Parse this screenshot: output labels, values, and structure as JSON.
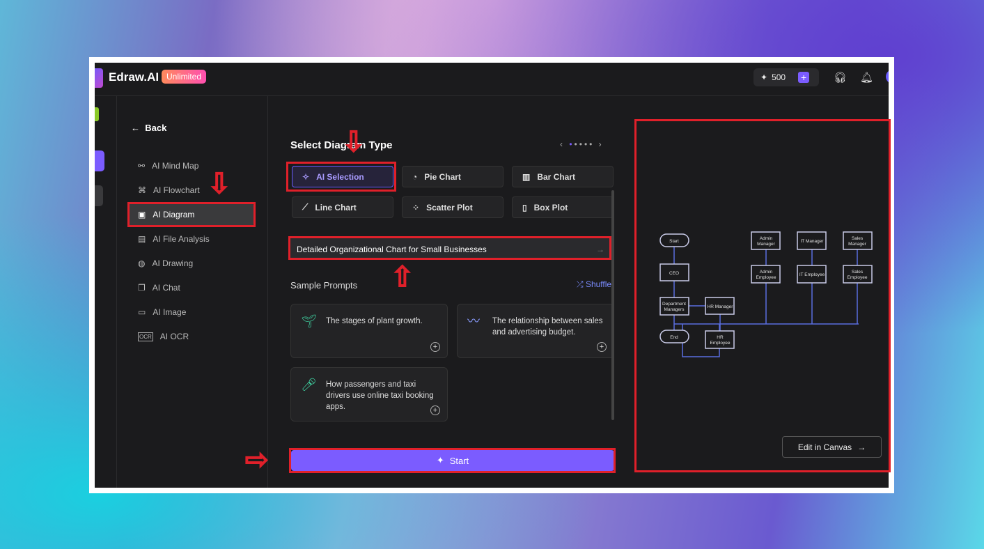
{
  "header": {
    "brand": "Edraw.AI",
    "badge": "Unlimited",
    "credits": "500"
  },
  "sidebar": {
    "back": "Back",
    "items": [
      {
        "label": "AI Mind Map",
        "icon": "mind-map-icon"
      },
      {
        "label": "AI Flowchart",
        "icon": "flowchart-icon"
      },
      {
        "label": "AI Diagram",
        "icon": "diagram-icon",
        "active": true
      },
      {
        "label": "AI File Analysis",
        "icon": "file-analysis-icon"
      },
      {
        "label": "AI Drawing",
        "icon": "palette-icon"
      },
      {
        "label": "AI Chat",
        "icon": "chat-icon"
      },
      {
        "label": "AI Image",
        "icon": "image-icon"
      },
      {
        "label": "AI OCR",
        "icon": "ocr-icon"
      }
    ]
  },
  "main": {
    "title": "Select Diagram Type",
    "types": [
      {
        "label": "AI Selection",
        "selected": true
      },
      {
        "label": "Pie Chart"
      },
      {
        "label": "Bar Chart"
      },
      {
        "label": "Line Chart"
      },
      {
        "label": "Scatter Plot"
      },
      {
        "label": "Box Plot"
      }
    ],
    "prompt": "Detailed Organizational Chart for Small Businesses",
    "sample_title": "Sample Prompts",
    "shuffle": "Shuffle",
    "samples": [
      "The stages of plant growth.",
      "The relationship between sales and advertising budget.",
      "How passengers and taxi drivers use online taxi booking apps."
    ],
    "start": "Start"
  },
  "preview": {
    "edit": "Edit in Canvas",
    "nodes": {
      "start": "Start",
      "ceo": "CEO",
      "dept1": "Department",
      "dept2": "Managers",
      "end": "End",
      "hrm": "HR Manager",
      "hre1": "HR",
      "hre2": "Employee",
      "am1": "Admin",
      "am2": "Manager",
      "ae1": "Admin",
      "ae2": "Employee",
      "itm": "IT Manager",
      "ite": "IT Employee",
      "sm1": "Sales",
      "sm2": "Manager",
      "se1": "Sales",
      "se2": "Employee"
    }
  },
  "colors": {
    "accent": "#7b5cff",
    "annotation": "#e0202a",
    "diagram_line": "#5a6ee0"
  }
}
